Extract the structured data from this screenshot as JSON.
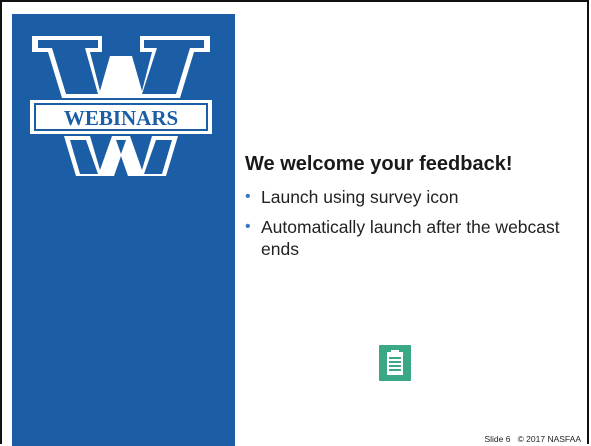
{
  "sidebar": {
    "logo_text": "WEBINARS",
    "color": "#1b5ea6"
  },
  "main": {
    "title": "We welcome your feedback!",
    "bullets": [
      "Launch using survey icon",
      "Automatically launch after the webcast ends"
    ]
  },
  "survey_icon": {
    "name": "clipboard-icon",
    "color": "#3aa886"
  },
  "footer": {
    "slide_label": "Slide 6",
    "copyright": "© 2017 NASFAA"
  }
}
